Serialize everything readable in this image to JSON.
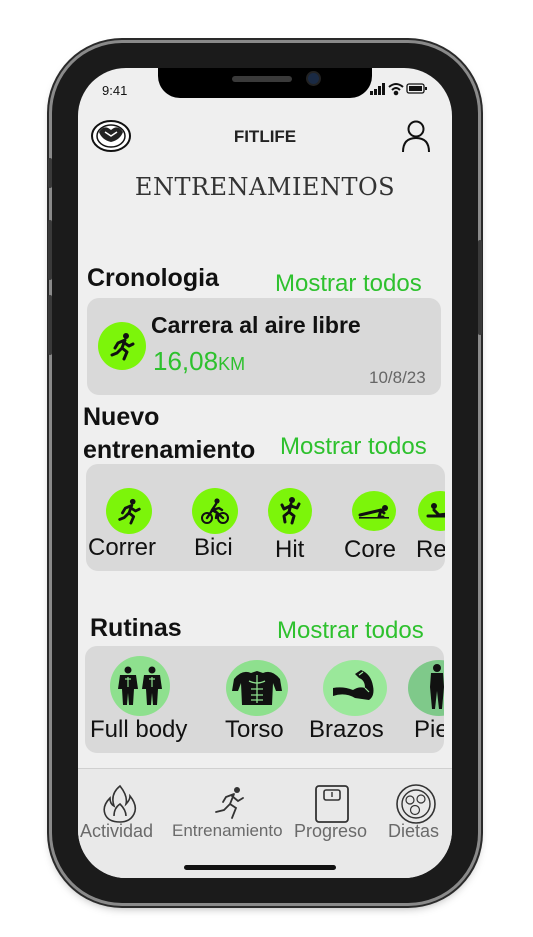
{
  "status": {
    "time": "9:41"
  },
  "header": {
    "app_name": "FITLIFE",
    "title": "ENTRENAMIENTOS"
  },
  "cronologia": {
    "title": "Cronologia",
    "show_all": "Mostrar todos",
    "item": {
      "name": "Carrera al aire libre",
      "distance": "16,08",
      "unit": "KM",
      "date": "10/8/23"
    }
  },
  "nuevo": {
    "title_line1": "Nuevo",
    "title_line2": "entrenamiento",
    "show_all": "Mostrar todos",
    "items": [
      {
        "label": "Correr",
        "icon": "runner-icon"
      },
      {
        "label": "Bici",
        "icon": "bike-icon"
      },
      {
        "label": "Hit",
        "icon": "hiit-icon"
      },
      {
        "label": "Core",
        "icon": "plank-icon"
      },
      {
        "label": "Re",
        "icon": "rowing-icon"
      }
    ]
  },
  "rutinas": {
    "title": "Rutinas",
    "show_all": "Mostrar todos",
    "items": [
      {
        "label": "Full body",
        "icon": "full-body-icon"
      },
      {
        "label": "Torso",
        "icon": "torso-icon"
      },
      {
        "label": "Brazos",
        "icon": "arm-icon"
      },
      {
        "label": "Pie",
        "icon": "legs-icon"
      }
    ]
  },
  "nav": {
    "items": [
      {
        "label": "Actividad",
        "icon": "flame-icon"
      },
      {
        "label": "Entrenamiento",
        "icon": "runner-icon"
      },
      {
        "label": "Progreso",
        "icon": "scale-icon"
      },
      {
        "label": "Dietas",
        "icon": "plate-icon"
      }
    ]
  },
  "colors": {
    "accent_green": "#2ec12e",
    "icon_green": "#7cf50a",
    "card_gray": "#d9d9d9",
    "screen_bg": "#efefef"
  }
}
